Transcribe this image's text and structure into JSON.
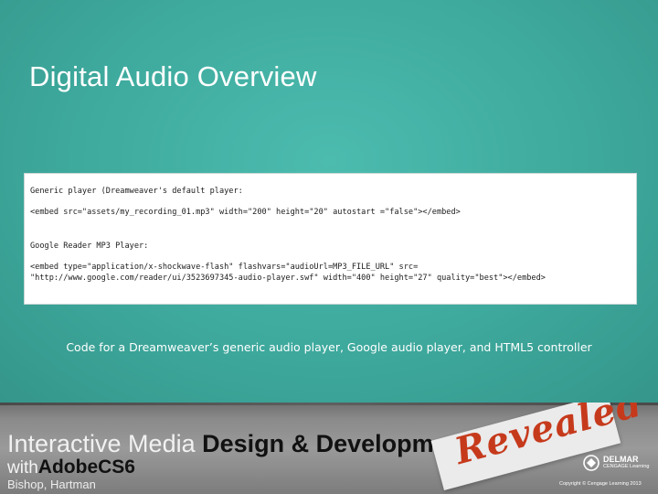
{
  "slide": {
    "title": "Digital Audio Overview",
    "caption": "Code for a Dreamweaver’s generic audio player, Google audio player, and HTML5 controller"
  },
  "code_box": {
    "line1": "Generic player (Dreamweaver's default player:",
    "line2": "<embed src=\"assets/my_recording_01.mp3\" width=\"200\" height=\"20\" autostart =\"false\"></embed>",
    "line3": "Google Reader MP3 Player:",
    "line4": "<embed type=\"application/x-shockwave-flash\" flashvars=\"audioUrl=MP3_FILE_URL\" src=",
    "line5": "\"http://www.google.com/reader/ui/3523697345-audio-player.swf\" width=\"400\" height=\"27\" quality=\"best\"></embed>"
  },
  "footer": {
    "series_part1": "Interactive Media ",
    "series_part2": "Design & Development",
    "with_text": "with",
    "adobe_text": "AdobeCS6",
    "authors": "Bishop, Hartman",
    "revealed": "Revealed",
    "publisher_name": "DELMAR",
    "publisher_sub": "CENGAGE Learning",
    "copyright": "Copyright © Cengage Learning 2013"
  },
  "colors": {
    "slide_background": "#3ea99d",
    "title_text": "#ffffff",
    "revealed_red": "#c63a1c"
  },
  "icons": {
    "publisher_logo": "delmar-logo-icon"
  }
}
